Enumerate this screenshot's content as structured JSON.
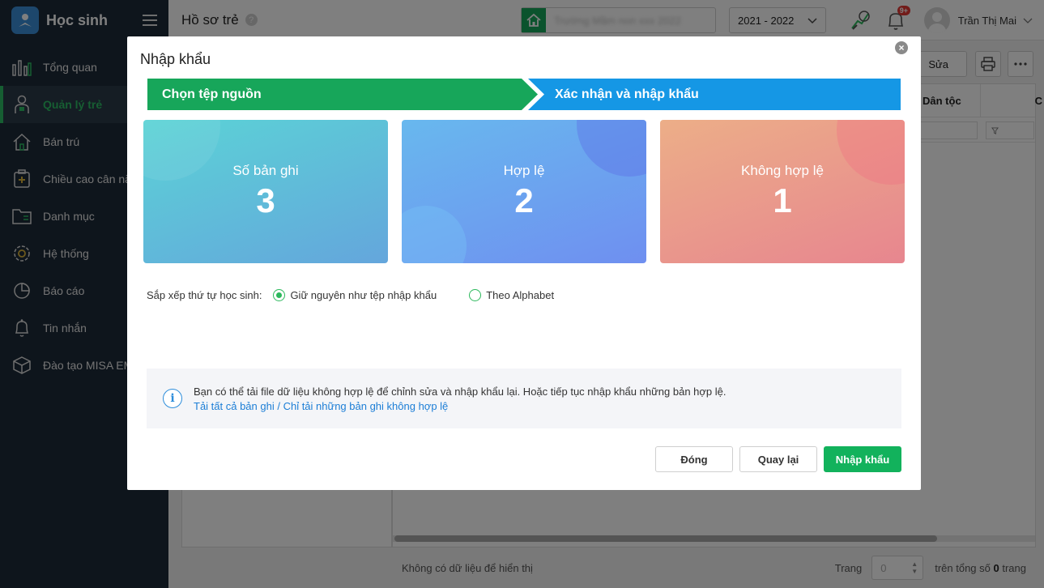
{
  "sidebar": {
    "app_title": "Học sinh",
    "items": [
      {
        "label": "Tổng quan",
        "icon": "bar-chart-icon"
      },
      {
        "label": "Quản lý trẻ",
        "icon": "child-icon"
      },
      {
        "label": "Bán trú",
        "icon": "house-icon"
      },
      {
        "label": "Chiều cao cân nặng",
        "icon": "plus-box-icon"
      },
      {
        "label": "Danh mục",
        "icon": "folder-icon"
      },
      {
        "label": "Hệ thống",
        "icon": "gear-icon"
      },
      {
        "label": "Báo cáo",
        "icon": "pie-icon"
      },
      {
        "label": "Tin nhắn",
        "icon": "bell-icon"
      },
      {
        "label": "Đào tạo MISA EMIS",
        "icon": "cube-icon"
      }
    ],
    "active_index": 1
  },
  "header": {
    "page_title": "Hồ sơ trẻ",
    "help": "?",
    "school_name": "Trường Mầm non xxx 2022",
    "school_year": "2021 - 2022",
    "notif_badge": "9+",
    "user_name": "Trần Thị Mai"
  },
  "background": {
    "edit_label": "Sửa",
    "col_ethnic": "Dân tộc",
    "col_next": "C",
    "empty_text": "Không có dữ liệu để hiển thị",
    "page_label": "Trang",
    "page_value": "0",
    "total_prefix": "trên tổng số",
    "total_value": "0",
    "total_suffix": "trang"
  },
  "modal": {
    "title": "Nhập khẩu",
    "close": "×",
    "steps": [
      "Chọn tệp nguồn",
      "Xác nhận và nhập khẩu"
    ],
    "cards": [
      {
        "label": "Số bản ghi",
        "value": "3"
      },
      {
        "label": "Hợp lệ",
        "value": "2"
      },
      {
        "label": "Không hợp lệ",
        "value": "1"
      }
    ],
    "sort_label": "Sắp xếp thứ tự học sinh:",
    "sort_options": [
      "Giữ nguyên như tệp nhập khẩu",
      "Theo Alphabet"
    ],
    "sort_selected": 0,
    "info_text": "Bạn có thể tải file dữ liệu không hợp lệ để chỉnh sửa và nhập khẩu lại. Hoặc tiếp tục nhập khẩu những bản hợp lệ.",
    "info_link_all": "Tải tất cả bản ghi",
    "info_link_sep": " / ",
    "info_link_invalid": "Chỉ tải những bản ghi không hợp lệ",
    "buttons": {
      "close": "Đóng",
      "back": "Quay lại",
      "import": "Nhập khẩu"
    }
  },
  "colors": {
    "step1": "#17a65a",
    "step2": "#1597e5",
    "primary": "#12b25c",
    "sidebar_bg": "#1d2a38"
  }
}
